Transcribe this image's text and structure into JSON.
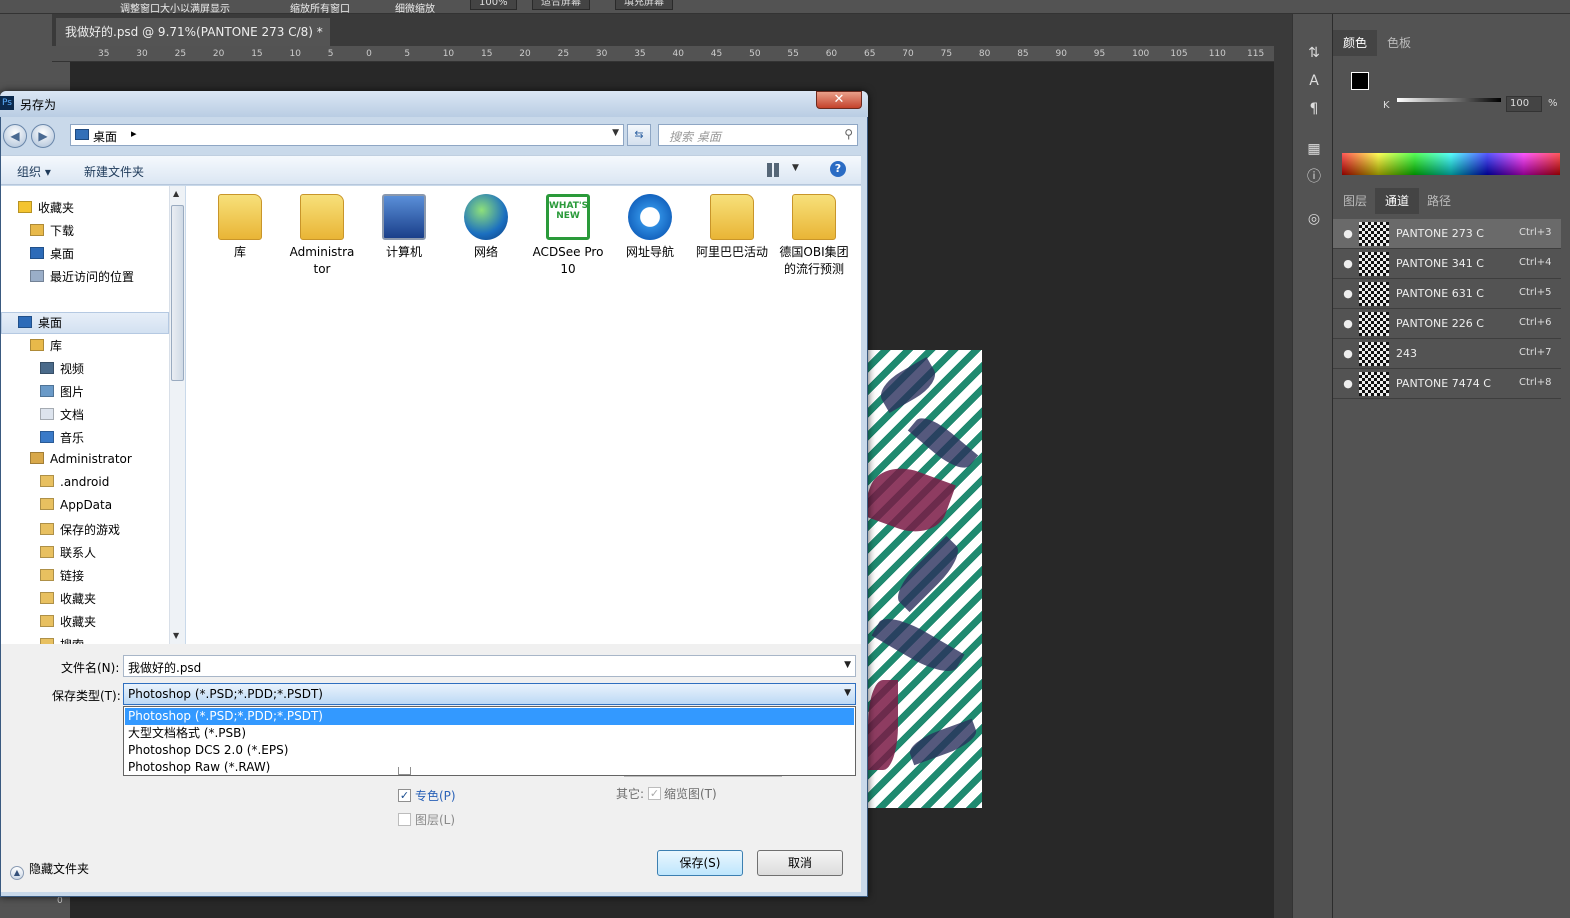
{
  "ps": {
    "options": {
      "chk1": "调整窗口大小以满屏显示",
      "chk2": "缩放所有窗口",
      "chk3": "细微缩放",
      "zoom": "100%",
      "fit": "适合屏幕",
      "fill": "填充屏幕"
    },
    "doc_tab": "我做好的.psd @ 9.71%(PANTONE 273 C/8) *",
    "doc_tab_close": "×",
    "ruler_ticks": [
      "35",
      "30",
      "25",
      "20",
      "15",
      "10",
      "5",
      "0",
      "5",
      "10",
      "15",
      "20",
      "25",
      "30",
      "35",
      "40",
      "45",
      "50",
      "55",
      "60",
      "65",
      "70",
      "75",
      "80",
      "85",
      "90",
      "95",
      "100",
      "105",
      "110",
      "115"
    ],
    "ruler_v_tick": "0",
    "right_tabs_top": {
      "color": "颜色",
      "swatches": "色板"
    },
    "color_slider": {
      "channel": "K",
      "value": "100",
      "unit": "%"
    },
    "right_tabs_mid": {
      "layers": "图层",
      "channels": "通道",
      "paths": "路径"
    },
    "channels": [
      {
        "name": "PANTONE 273 C",
        "shortcut": "Ctrl+3"
      },
      {
        "name": "PANTONE 341 C",
        "shortcut": "Ctrl+4"
      },
      {
        "name": "PANTONE 631 C",
        "shortcut": "Ctrl+5"
      },
      {
        "name": "PANTONE 226 C",
        "shortcut": "Ctrl+6"
      },
      {
        "name": "243",
        "shortcut": "Ctrl+7"
      },
      {
        "name": "PANTONE 7474 C",
        "shortcut": "Ctrl+8"
      }
    ],
    "eye_glyph": "●"
  },
  "dialog": {
    "title": "另存为",
    "ps_icon": "Ps",
    "close": "✕",
    "address": "桌面",
    "search_placeholder": "搜索 桌面",
    "toolbar": {
      "organize": "组织 ▾",
      "new_folder": "新建文件夹"
    },
    "help": "?",
    "nav": {
      "favorites": "收藏夹",
      "downloads": "下载",
      "desktop": "桌面",
      "recent": "最近访问的位置",
      "desktop2": "桌面",
      "libraries": "库",
      "videos": "视频",
      "pictures": "图片",
      "documents": "文档",
      "music": "音乐",
      "admin": "Administrator",
      "android": ".android",
      "appdata": "AppData",
      "savedgames": "保存的游戏",
      "contacts": "联系人",
      "links": "链接",
      "fav1": "收藏夹",
      "fav2": "收藏夹",
      "search": "搜索"
    },
    "files": [
      {
        "label": "库"
      },
      {
        "label": "Administra tor"
      },
      {
        "label": "计算机"
      },
      {
        "label": "网络"
      },
      {
        "label": "ACDSee Pro 10",
        "badge": "WHAT'S NEW"
      },
      {
        "label": "网址导航"
      },
      {
        "label": "阿里巴巴活动"
      },
      {
        "label": "德国OBI集团的流行预测"
      }
    ],
    "filename_label": "文件名(N):",
    "filename": "我做好的.psd",
    "filetype_label": "保存类型(T):",
    "filetype": "Photoshop (*.PSD;*.PDD;*.PSDT)",
    "filetype_options": [
      "Photoshop (*.PSD;*.PDD;*.PSDT)",
      "大型文档格式 (*.PSB)",
      "Photoshop DCS 2.0 (*.EPS)",
      "Photoshop Raw (*.RAW)"
    ],
    "spot_colors": "专色(P)",
    "layers": "图层(L)",
    "other_label": "其它:",
    "thumbnail": "缩览图(T)",
    "save": "保存(S)",
    "cancel": "取消",
    "hide_folders": "隐藏文件夹",
    "check": "✓"
  }
}
